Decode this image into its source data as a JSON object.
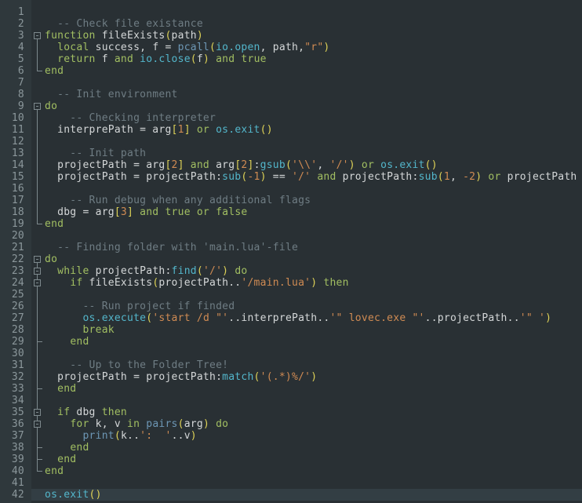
{
  "editor": {
    "language": "lua",
    "caret_line_number": 42,
    "colors": {
      "bg": "#293034",
      "gutter": "#2f383c",
      "num": "#8b979b",
      "caretline": "#333e44",
      "fold": "#7d898d",
      "text": "#d4d7d8",
      "keyword": "#a2bf62",
      "comment": "#6f7d84",
      "string": "#d08b53",
      "library": "#53b6cb",
      "builtin": "#6d97b5",
      "bracket": "#ded257"
    },
    "lines": [
      {
        "n": "1",
        "fold": "",
        "tokens": []
      },
      {
        "n": "2",
        "fold": "",
        "tokens": [
          [
            "c",
            "  -- Check file existance"
          ]
        ]
      },
      {
        "n": "3",
        "fold": "box",
        "tokens": [
          [
            "k",
            "function"
          ],
          [
            "w",
            " fileExists"
          ],
          [
            "y",
            "("
          ],
          [
            "w",
            "path"
          ],
          [
            "y",
            ")"
          ]
        ]
      },
      {
        "n": "4",
        "fold": "line",
        "tokens": [
          [
            "w",
            "  "
          ],
          [
            "k",
            "local"
          ],
          [
            "w",
            " success, f = "
          ],
          [
            "b",
            "pcall"
          ],
          [
            "y",
            "("
          ],
          [
            "f",
            "io.open"
          ],
          [
            "w",
            ", path,"
          ],
          [
            "s",
            "\"r\""
          ],
          [
            "y",
            ")"
          ]
        ]
      },
      {
        "n": "5",
        "fold": "line",
        "tokens": [
          [
            "w",
            "  "
          ],
          [
            "k",
            "return"
          ],
          [
            "w",
            " f "
          ],
          [
            "k",
            "and"
          ],
          [
            "w",
            " "
          ],
          [
            "f",
            "io.close"
          ],
          [
            "y",
            "("
          ],
          [
            "w",
            "f"
          ],
          [
            "y",
            ")"
          ],
          [
            "w",
            " "
          ],
          [
            "k",
            "and"
          ],
          [
            "w",
            " "
          ],
          [
            "k",
            "true"
          ]
        ]
      },
      {
        "n": "6",
        "fold": "end",
        "tokens": [
          [
            "k",
            "end"
          ]
        ]
      },
      {
        "n": "7",
        "fold": "",
        "tokens": []
      },
      {
        "n": "8",
        "fold": "",
        "tokens": [
          [
            "c",
            "  -- Init environment"
          ]
        ]
      },
      {
        "n": "9",
        "fold": "box",
        "tokens": [
          [
            "k",
            "do"
          ]
        ]
      },
      {
        "n": "10",
        "fold": "line",
        "tokens": [
          [
            "c",
            "    -- Checking interpreter"
          ]
        ]
      },
      {
        "n": "11",
        "fold": "line",
        "tokens": [
          [
            "w",
            "  interprePath = arg"
          ],
          [
            "y",
            "["
          ],
          [
            "s",
            "1"
          ],
          [
            "y",
            "]"
          ],
          [
            "w",
            " "
          ],
          [
            "k",
            "or"
          ],
          [
            "w",
            " "
          ],
          [
            "f",
            "os.exit"
          ],
          [
            "y",
            "()"
          ]
        ]
      },
      {
        "n": "12",
        "fold": "line",
        "tokens": []
      },
      {
        "n": "13",
        "fold": "line",
        "tokens": [
          [
            "c",
            "    -- Init path"
          ]
        ]
      },
      {
        "n": "14",
        "fold": "line",
        "tokens": [
          [
            "w",
            "  projectPath = arg"
          ],
          [
            "y",
            "["
          ],
          [
            "s",
            "2"
          ],
          [
            "y",
            "]"
          ],
          [
            "w",
            " "
          ],
          [
            "k",
            "and"
          ],
          [
            "w",
            " arg"
          ],
          [
            "y",
            "["
          ],
          [
            "s",
            "2"
          ],
          [
            "y",
            "]"
          ],
          [
            "w",
            ":"
          ],
          [
            "f",
            "gsub"
          ],
          [
            "y",
            "("
          ],
          [
            "s",
            "'\\\\'"
          ],
          [
            "w",
            ", "
          ],
          [
            "s",
            "'/'"
          ],
          [
            "y",
            ")"
          ],
          [
            "w",
            " "
          ],
          [
            "k",
            "or"
          ],
          [
            "w",
            " "
          ],
          [
            "f",
            "os.exit"
          ],
          [
            "y",
            "()"
          ]
        ]
      },
      {
        "n": "15",
        "fold": "line",
        "tokens": [
          [
            "w",
            "  projectPath = projectPath:"
          ],
          [
            "f",
            "sub"
          ],
          [
            "y",
            "("
          ],
          [
            "s",
            "-1"
          ],
          [
            "y",
            ")"
          ],
          [
            "w",
            " == "
          ],
          [
            "s",
            "'/'"
          ],
          [
            "w",
            " "
          ],
          [
            "k",
            "and"
          ],
          [
            "w",
            " projectPath:"
          ],
          [
            "f",
            "sub"
          ],
          [
            "y",
            "("
          ],
          [
            "s",
            "1"
          ],
          [
            "w",
            ", "
          ],
          [
            "s",
            "-2"
          ],
          [
            "y",
            ")"
          ],
          [
            "w",
            " "
          ],
          [
            "k",
            "or"
          ],
          [
            "w",
            " projectPath"
          ]
        ]
      },
      {
        "n": "16",
        "fold": "line",
        "tokens": []
      },
      {
        "n": "17",
        "fold": "line",
        "tokens": [
          [
            "c",
            "    -- Run debug when any additional flags"
          ]
        ]
      },
      {
        "n": "18",
        "fold": "line",
        "tokens": [
          [
            "w",
            "  dbg = arg"
          ],
          [
            "y",
            "["
          ],
          [
            "s",
            "3"
          ],
          [
            "y",
            "]"
          ],
          [
            "w",
            " "
          ],
          [
            "k",
            "and"
          ],
          [
            "w",
            " "
          ],
          [
            "k",
            "true"
          ],
          [
            "w",
            " "
          ],
          [
            "k",
            "or"
          ],
          [
            "w",
            " "
          ],
          [
            "k",
            "false"
          ]
        ]
      },
      {
        "n": "19",
        "fold": "end",
        "tokens": [
          [
            "k",
            "end"
          ]
        ]
      },
      {
        "n": "20",
        "fold": "",
        "tokens": []
      },
      {
        "n": "21",
        "fold": "",
        "tokens": [
          [
            "c",
            "  -- Finding folder with 'main.lua'-file"
          ]
        ]
      },
      {
        "n": "22",
        "fold": "box",
        "tokens": [
          [
            "k",
            "do"
          ]
        ]
      },
      {
        "n": "23",
        "fold": "boxl",
        "tokens": [
          [
            "w",
            "  "
          ],
          [
            "k",
            "while"
          ],
          [
            "w",
            " projectPath:"
          ],
          [
            "f",
            "find"
          ],
          [
            "y",
            "("
          ],
          [
            "s",
            "'/'"
          ],
          [
            "y",
            ")"
          ],
          [
            "w",
            " "
          ],
          [
            "k",
            "do"
          ]
        ]
      },
      {
        "n": "24",
        "fold": "boxl",
        "tokens": [
          [
            "w",
            "    "
          ],
          [
            "k",
            "if"
          ],
          [
            "w",
            " fileExists"
          ],
          [
            "y",
            "("
          ],
          [
            "w",
            "projectPath.."
          ],
          [
            "s",
            "'/main.lua'"
          ],
          [
            "y",
            ")"
          ],
          [
            "w",
            " "
          ],
          [
            "k",
            "then"
          ]
        ]
      },
      {
        "n": "25",
        "fold": "line",
        "tokens": []
      },
      {
        "n": "26",
        "fold": "line",
        "tokens": [
          [
            "c",
            "      -- Run project if finded"
          ]
        ]
      },
      {
        "n": "27",
        "fold": "line",
        "tokens": [
          [
            "w",
            "      "
          ],
          [
            "f",
            "os.execute"
          ],
          [
            "y",
            "("
          ],
          [
            "s",
            "'start /d \"'"
          ],
          [
            "w",
            "..interprePath.."
          ],
          [
            "s",
            "'\" lovec.exe \"'"
          ],
          [
            "w",
            "..projectPath.."
          ],
          [
            "s",
            "'\" '"
          ],
          [
            "y",
            ")"
          ]
        ]
      },
      {
        "n": "28",
        "fold": "line",
        "tokens": [
          [
            "w",
            "      "
          ],
          [
            "k",
            "break"
          ]
        ]
      },
      {
        "n": "29",
        "fold": "tee",
        "tokens": [
          [
            "w",
            "    "
          ],
          [
            "k",
            "end"
          ]
        ]
      },
      {
        "n": "30",
        "fold": "line",
        "tokens": []
      },
      {
        "n": "31",
        "fold": "line",
        "tokens": [
          [
            "c",
            "    -- Up to the Folder Tree!"
          ]
        ]
      },
      {
        "n": "32",
        "fold": "line",
        "tokens": [
          [
            "w",
            "  projectPath = projectPath:"
          ],
          [
            "f",
            "match"
          ],
          [
            "y",
            "("
          ],
          [
            "s",
            "'(.*)%/'"
          ],
          [
            "y",
            ")"
          ]
        ]
      },
      {
        "n": "33",
        "fold": "tee",
        "tokens": [
          [
            "w",
            "  "
          ],
          [
            "k",
            "end"
          ]
        ]
      },
      {
        "n": "34",
        "fold": "line",
        "tokens": []
      },
      {
        "n": "35",
        "fold": "boxl",
        "tokens": [
          [
            "w",
            "  "
          ],
          [
            "k",
            "if"
          ],
          [
            "w",
            " dbg "
          ],
          [
            "k",
            "then"
          ]
        ]
      },
      {
        "n": "36",
        "fold": "boxl",
        "tokens": [
          [
            "w",
            "    "
          ],
          [
            "k",
            "for"
          ],
          [
            "w",
            " k, v "
          ],
          [
            "k",
            "in"
          ],
          [
            "w",
            " "
          ],
          [
            "b",
            "pairs"
          ],
          [
            "y",
            "("
          ],
          [
            "w",
            "arg"
          ],
          [
            "y",
            ")"
          ],
          [
            "w",
            " "
          ],
          [
            "k",
            "do"
          ]
        ]
      },
      {
        "n": "37",
        "fold": "line",
        "tokens": [
          [
            "w",
            "      "
          ],
          [
            "b",
            "print"
          ],
          [
            "y",
            "("
          ],
          [
            "w",
            "k.."
          ],
          [
            "s",
            "':  '"
          ],
          [
            "w",
            "..v"
          ],
          [
            "y",
            ")"
          ]
        ]
      },
      {
        "n": "38",
        "fold": "tee",
        "tokens": [
          [
            "w",
            "    "
          ],
          [
            "k",
            "end"
          ]
        ]
      },
      {
        "n": "39",
        "fold": "tee",
        "tokens": [
          [
            "w",
            "  "
          ],
          [
            "k",
            "end"
          ]
        ]
      },
      {
        "n": "40",
        "fold": "end",
        "tokens": [
          [
            "k",
            "end"
          ]
        ]
      },
      {
        "n": "41",
        "fold": "",
        "tokens": []
      },
      {
        "n": "42",
        "fold": "",
        "tokens": [
          [
            "f",
            "os.exit"
          ],
          [
            "y",
            "()"
          ]
        ]
      }
    ]
  }
}
